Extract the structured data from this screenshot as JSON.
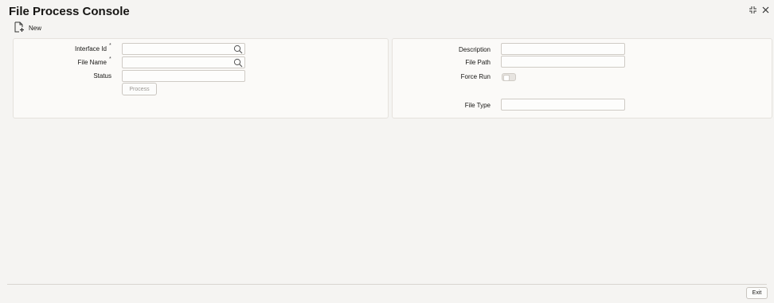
{
  "window": {
    "title": "File Process Console",
    "restore_icon": "collapse-arrows-icon",
    "close_icon": "close-icon"
  },
  "toolbar": {
    "new_label": "New",
    "new_icon": "new-document-icon"
  },
  "form_left": {
    "interface_id_label": "Interface Id",
    "interface_id_value": "",
    "file_name_label": "File Name",
    "file_name_value": "",
    "status_label": "Status",
    "status_value": "",
    "required_marker": "*",
    "process_button": "Process"
  },
  "form_right": {
    "description_label": "Description",
    "description_value": "",
    "file_path_label": "File Path",
    "file_path_value": "",
    "force_run_label": "Force Run",
    "force_run_on": false,
    "file_type_label": "File Type",
    "file_type_value": ""
  },
  "footer": {
    "exit_label": "Exit"
  }
}
